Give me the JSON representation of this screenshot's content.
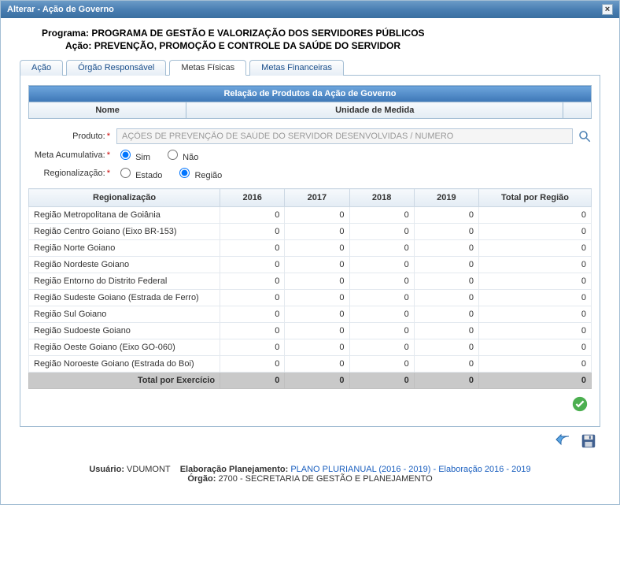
{
  "window": {
    "title": "Alterar - Ação de Governo"
  },
  "header": {
    "programa_label": "Programa:",
    "programa_value": "PROGRAMA DE GESTÃO E VALORIZAÇÃO DOS SERVIDORES PÚBLICOS",
    "acao_label": "Ação:",
    "acao_value": "PREVENÇÃO, PROMOÇÃO E CONTROLE DA SAÚDE DO SERVIDOR"
  },
  "tabs": {
    "acao": "Ação",
    "orgao": "Órgão Responsável",
    "metas_fisicas": "Metas Físicas",
    "metas_financeiras": "Metas Financeiras"
  },
  "produtos": {
    "relacao_title": "Relação de Produtos da Ação de Governo",
    "col_nome": "Nome",
    "col_unidade": "Unidade de Medida"
  },
  "form": {
    "produto_label": "Produto:",
    "produto_value": "AÇÕES DE PREVENÇÃO DE SAÚDE DO SERVIDOR DESENVOLVIDAS / NUMERO",
    "meta_label": "Meta Acumulativa:",
    "sim": "Sim",
    "nao": "Não",
    "regionalizacao_label": "Regionalização:",
    "estado": "Estado",
    "regiao": "Região"
  },
  "chart_data": {
    "type": "table",
    "columns": [
      "Regionalização",
      "2016",
      "2017",
      "2018",
      "2019",
      "Total por Região"
    ],
    "rows": [
      {
        "name": "Região Metropolitana de Goiânia",
        "v2016": 0,
        "v2017": 0,
        "v2018": 0,
        "v2019": 0,
        "total": 0
      },
      {
        "name": "Região Centro Goiano (Eixo BR-153)",
        "v2016": 0,
        "v2017": 0,
        "v2018": 0,
        "v2019": 0,
        "total": 0
      },
      {
        "name": "Região Norte Goiano",
        "v2016": 0,
        "v2017": 0,
        "v2018": 0,
        "v2019": 0,
        "total": 0
      },
      {
        "name": "Região Nordeste Goiano",
        "v2016": 0,
        "v2017": 0,
        "v2018": 0,
        "v2019": 0,
        "total": 0
      },
      {
        "name": "Região Entorno do Distrito Federal",
        "v2016": 0,
        "v2017": 0,
        "v2018": 0,
        "v2019": 0,
        "total": 0
      },
      {
        "name": "Região Sudeste Goiano (Estrada de Ferro)",
        "v2016": 0,
        "v2017": 0,
        "v2018": 0,
        "v2019": 0,
        "total": 0
      },
      {
        "name": "Região Sul Goiano",
        "v2016": 0,
        "v2017": 0,
        "v2018": 0,
        "v2019": 0,
        "total": 0
      },
      {
        "name": "Região Sudoeste Goiano",
        "v2016": 0,
        "v2017": 0,
        "v2018": 0,
        "v2019": 0,
        "total": 0
      },
      {
        "name": "Região Oeste Goiano (Eixo GO-060)",
        "v2016": 0,
        "v2017": 0,
        "v2018": 0,
        "v2019": 0,
        "total": 0
      },
      {
        "name": "Região Noroeste Goiano (Estrada do Boi)",
        "v2016": 0,
        "v2017": 0,
        "v2018": 0,
        "v2019": 0,
        "total": 0
      }
    ],
    "total_label": "Total por Exercício",
    "totals": {
      "v2016": 0,
      "v2017": 0,
      "v2018": 0,
      "v2019": 0,
      "total": 0
    }
  },
  "footer": {
    "usuario_label": "Usuário:",
    "usuario_value": "VDUMONT",
    "elab_label": "Elaboração Planejamento:",
    "elab_link": "PLANO PLURIANUAL (2016 - 2019) - Elaboração 2016 - 2019",
    "orgao_label": "Órgão:",
    "orgao_value": "2700 - SECRETARIA DE GESTÃO E PLANEJAMENTO"
  }
}
